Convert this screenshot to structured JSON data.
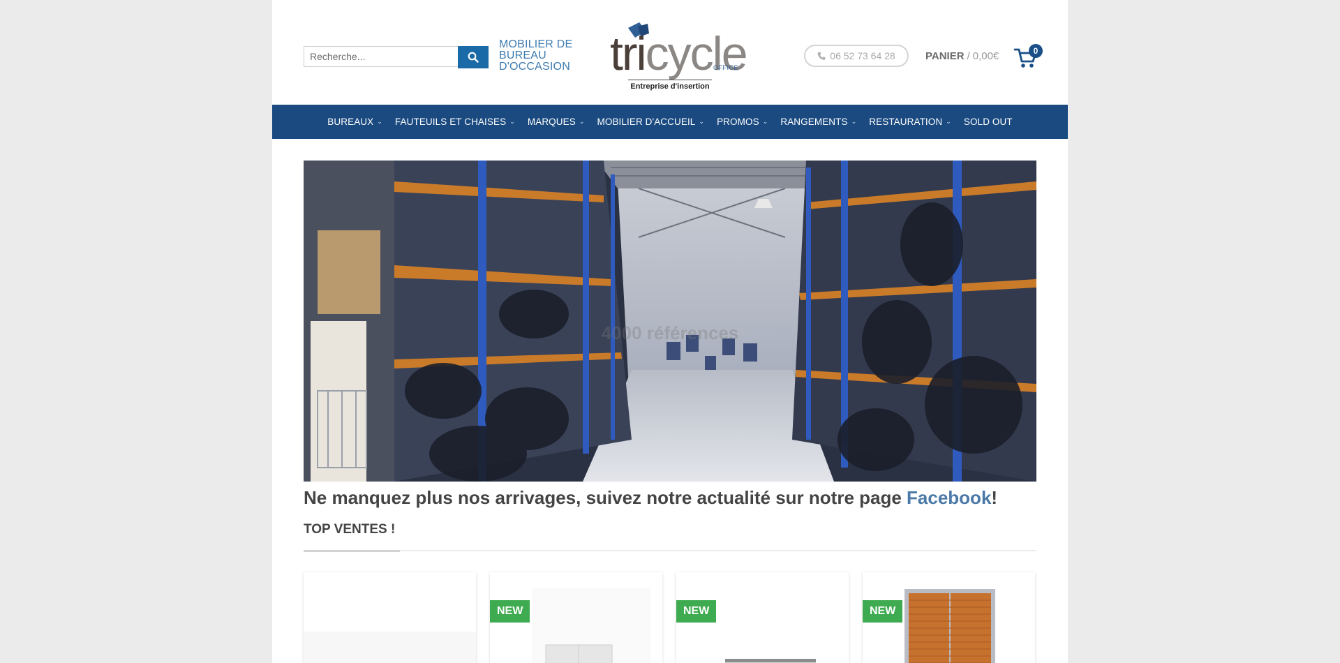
{
  "header": {
    "search_placeholder": "Recherche...",
    "tagline": "MOBILIER DE BUREAU D'OCCASION",
    "logo": {
      "word_part1": "tri",
      "word_part2": "cycle",
      "suffix": "OFFICE",
      "subtitle": "Entreprise d'insertion"
    },
    "phone": "06 52 73 64 28",
    "cart": {
      "label": "PANIER",
      "separator": "/",
      "amount": "0,00€",
      "count": "0"
    }
  },
  "nav": {
    "items": [
      {
        "label": "BUREAUX",
        "has_dropdown": true
      },
      {
        "label": "FAUTEUILS ET CHAISES",
        "has_dropdown": true
      },
      {
        "label": "MARQUES",
        "has_dropdown": true
      },
      {
        "label": "MOBILIER D'ACCUEIL",
        "has_dropdown": true
      },
      {
        "label": "PROMOS",
        "has_dropdown": true
      },
      {
        "label": "RANGEMENTS",
        "has_dropdown": true
      },
      {
        "label": "RESTAURATION",
        "has_dropdown": true
      },
      {
        "label": "SOLD OUT",
        "has_dropdown": false
      }
    ],
    "chevron": "⌄"
  },
  "hero": {
    "caption": "4000 références"
  },
  "announcement": {
    "text": "Ne manquez plus nos arrivages, suivez notre actualité sur notre page ",
    "link_text": "Facebook",
    "suffix": "!"
  },
  "top_sales": {
    "title": "TOP VENTES !",
    "products": [
      {
        "badge": ""
      },
      {
        "badge": "NEW"
      },
      {
        "badge": "NEW"
      },
      {
        "badge": "NEW"
      }
    ]
  },
  "colors": {
    "nav_bg": "#1a4a80",
    "accent_blue": "#1a6aa8",
    "badge_green": "#3fab51",
    "link_blue": "#4a79a8"
  },
  "icons": {
    "search": "search-icon",
    "phone": "phone-icon",
    "cart": "cart-icon",
    "chevron": "chevron-down-icon"
  }
}
